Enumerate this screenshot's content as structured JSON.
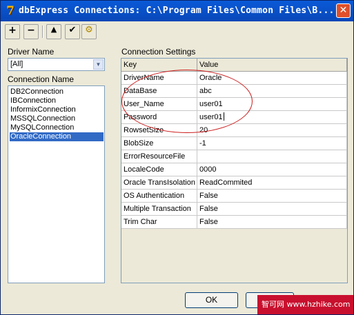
{
  "window": {
    "title": "dbExpress Connections: C:\\Program Files\\Common Files\\B...",
    "close_glyph": "✕"
  },
  "toolbar": {
    "add_glyph": "+",
    "remove_glyph": "−",
    "up_glyph": "▲",
    "check_glyph": "✔",
    "config_glyph": "⚙"
  },
  "driver": {
    "label": "Driver Name",
    "selected": "[All]"
  },
  "connections": {
    "label": "Connection Name",
    "items": [
      "DB2Connection",
      "IBConnection",
      "InformixConnection",
      "MSSQLConnection",
      "MySQLConnection",
      "OracleConnection"
    ],
    "selected_index": 5
  },
  "settings": {
    "label": "Connection Settings",
    "columns": [
      "Key",
      "Value"
    ],
    "rows": [
      {
        "key": "DriverName",
        "value": "Oracle"
      },
      {
        "key": "DataBase",
        "value": "abc"
      },
      {
        "key": "User_Name",
        "value": "user01"
      },
      {
        "key": "Password",
        "value": "user01"
      },
      {
        "key": "RowsetSize",
        "value": "20"
      },
      {
        "key": "BlobSize",
        "value": "-1"
      },
      {
        "key": "ErrorResourceFile",
        "value": ""
      },
      {
        "key": "LocaleCode",
        "value": "0000"
      },
      {
        "key": "Oracle TransIsolation",
        "value": "ReadCommited"
      },
      {
        "key": "OS Authentication",
        "value": "False"
      },
      {
        "key": "Multiple Transaction",
        "value": "False"
      },
      {
        "key": "Trim Char",
        "value": "False"
      }
    ]
  },
  "buttons": {
    "ok": "OK",
    "cancel": "Cancel"
  },
  "watermark": {
    "text": "智可网 www.hzhike.com"
  }
}
